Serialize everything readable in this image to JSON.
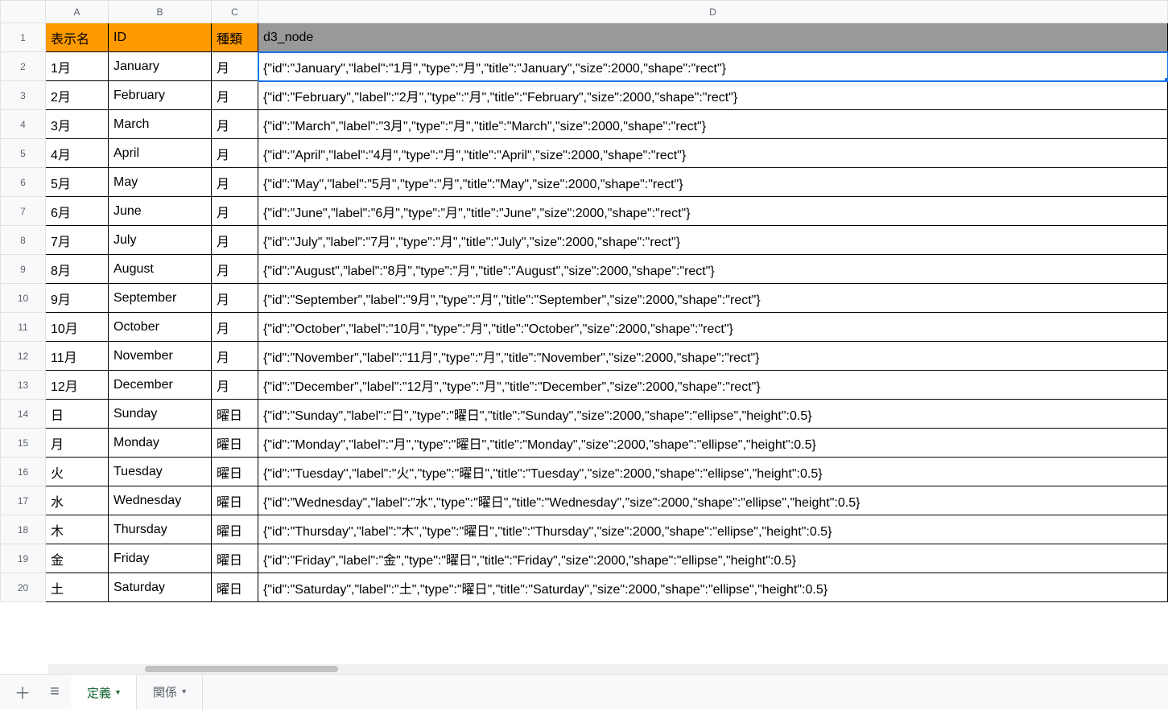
{
  "columns": [
    "A",
    "B",
    "C",
    "D"
  ],
  "header": {
    "A": "表示名",
    "B": "ID",
    "C": "種類",
    "D": "d3_node"
  },
  "active_cell": {
    "row": 2,
    "col": "D"
  },
  "rows": [
    {
      "n": 2,
      "A": "1月",
      "B": "January",
      "C": "月",
      "D": "{\"id\":\"January\",\"label\":\"1月\",\"type\":\"月\",\"title\":\"January\",\"size\":2000,\"shape\":\"rect\"}"
    },
    {
      "n": 3,
      "A": "2月",
      "B": "February",
      "C": "月",
      "D": "{\"id\":\"February\",\"label\":\"2月\",\"type\":\"月\",\"title\":\"February\",\"size\":2000,\"shape\":\"rect\"}"
    },
    {
      "n": 4,
      "A": "3月",
      "B": "March",
      "C": "月",
      "D": "{\"id\":\"March\",\"label\":\"3月\",\"type\":\"月\",\"title\":\"March\",\"size\":2000,\"shape\":\"rect\"}"
    },
    {
      "n": 5,
      "A": "4月",
      "B": "April",
      "C": "月",
      "D": "{\"id\":\"April\",\"label\":\"4月\",\"type\":\"月\",\"title\":\"April\",\"size\":2000,\"shape\":\"rect\"}"
    },
    {
      "n": 6,
      "A": "5月",
      "B": "May",
      "C": "月",
      "D": "{\"id\":\"May\",\"label\":\"5月\",\"type\":\"月\",\"title\":\"May\",\"size\":2000,\"shape\":\"rect\"}"
    },
    {
      "n": 7,
      "A": "6月",
      "B": "June",
      "C": "月",
      "D": "{\"id\":\"June\",\"label\":\"6月\",\"type\":\"月\",\"title\":\"June\",\"size\":2000,\"shape\":\"rect\"}"
    },
    {
      "n": 8,
      "A": "7月",
      "B": "July",
      "C": "月",
      "D": "{\"id\":\"July\",\"label\":\"7月\",\"type\":\"月\",\"title\":\"July\",\"size\":2000,\"shape\":\"rect\"}"
    },
    {
      "n": 9,
      "A": "8月",
      "B": "August",
      "C": "月",
      "D": "{\"id\":\"August\",\"label\":\"8月\",\"type\":\"月\",\"title\":\"August\",\"size\":2000,\"shape\":\"rect\"}"
    },
    {
      "n": 10,
      "A": "9月",
      "B": "September",
      "C": "月",
      "D": "{\"id\":\"September\",\"label\":\"9月\",\"type\":\"月\",\"title\":\"September\",\"size\":2000,\"shape\":\"rect\"}"
    },
    {
      "n": 11,
      "A": "10月",
      "B": "October",
      "C": "月",
      "D": "{\"id\":\"October\",\"label\":\"10月\",\"type\":\"月\",\"title\":\"October\",\"size\":2000,\"shape\":\"rect\"}"
    },
    {
      "n": 12,
      "A": "11月",
      "B": "November",
      "C": "月",
      "D": "{\"id\":\"November\",\"label\":\"11月\",\"type\":\"月\",\"title\":\"November\",\"size\":2000,\"shape\":\"rect\"}"
    },
    {
      "n": 13,
      "A": "12月",
      "B": "December",
      "C": "月",
      "D": "{\"id\":\"December\",\"label\":\"12月\",\"type\":\"月\",\"title\":\"December\",\"size\":2000,\"shape\":\"rect\"}"
    },
    {
      "n": 14,
      "A": "日",
      "B": "Sunday",
      "C": "曜日",
      "D": "{\"id\":\"Sunday\",\"label\":\"日\",\"type\":\"曜日\",\"title\":\"Sunday\",\"size\":2000,\"shape\":\"ellipse\",\"height\":0.5}"
    },
    {
      "n": 15,
      "A": "月",
      "B": "Monday",
      "C": "曜日",
      "D": "{\"id\":\"Monday\",\"label\":\"月\",\"type\":\"曜日\",\"title\":\"Monday\",\"size\":2000,\"shape\":\"ellipse\",\"height\":0.5}"
    },
    {
      "n": 16,
      "A": "火",
      "B": "Tuesday",
      "C": "曜日",
      "D": "{\"id\":\"Tuesday\",\"label\":\"火\",\"type\":\"曜日\",\"title\":\"Tuesday\",\"size\":2000,\"shape\":\"ellipse\",\"height\":0.5}"
    },
    {
      "n": 17,
      "A": "水",
      "B": "Wednesday",
      "C": "曜日",
      "D": "{\"id\":\"Wednesday\",\"label\":\"水\",\"type\":\"曜日\",\"title\":\"Wednesday\",\"size\":2000,\"shape\":\"ellipse\",\"height\":0.5}"
    },
    {
      "n": 18,
      "A": "木",
      "B": "Thursday",
      "C": "曜日",
      "D": "{\"id\":\"Thursday\",\"label\":\"木\",\"type\":\"曜日\",\"title\":\"Thursday\",\"size\":2000,\"shape\":\"ellipse\",\"height\":0.5}"
    },
    {
      "n": 19,
      "A": "金",
      "B": "Friday",
      "C": "曜日",
      "D": "{\"id\":\"Friday\",\"label\":\"金\",\"type\":\"曜日\",\"title\":\"Friday\",\"size\":2000,\"shape\":\"ellipse\",\"height\":0.5}"
    },
    {
      "n": 20,
      "A": "土",
      "B": "Saturday",
      "C": "曜日",
      "D": "{\"id\":\"Saturday\",\"label\":\"土\",\"type\":\"曜日\",\"title\":\"Saturday\",\"size\":2000,\"shape\":\"ellipse\",\"height\":0.5}"
    }
  ],
  "tabs": {
    "active": "定義",
    "items": [
      "定義",
      "関係"
    ]
  }
}
